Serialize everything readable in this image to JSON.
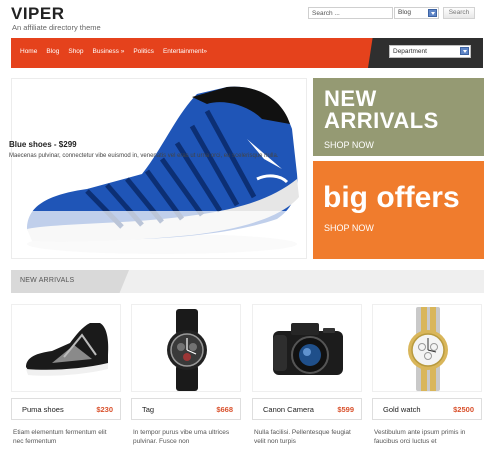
{
  "header": {
    "logo": "VIPER",
    "tagline": "An affiliate directory theme",
    "search_placeholder": "Search ...",
    "search_scope": "Blog",
    "search_button": "Search"
  },
  "nav": {
    "items": [
      "Home",
      "Blog",
      "Shop",
      "Business »",
      "Politics",
      "Entertainment»"
    ],
    "department_select": "Department"
  },
  "hero": {
    "title": "Blue shoes - $299",
    "description": "Maecenas pulvinar, connectetur vibe euismod in, venenatis vel eras ut urna orci, eu scelerisque nulla."
  },
  "promos": {
    "new_arrivals_line1": "NEW",
    "new_arrivals_line2": "ARRIVALS",
    "new_arrivals_cta": "SHOP NOW",
    "big_offers": "big offers",
    "big_offers_cta": "SHOP NOW"
  },
  "section": {
    "title": "NEW ARRIVALS"
  },
  "products": [
    {
      "name": "Puma shoes",
      "price": "$230",
      "description": "Etiam elementum fermentum elit nec fermentum"
    },
    {
      "name": "Tag",
      "price": "$668",
      "description": "In tempor purus vibe uma ultrices pulvinar. Fusce non"
    },
    {
      "name": "Canon Camera",
      "price": "$599",
      "description": "Nulla facilisi. Pellentesque feugiat velit non turpis"
    },
    {
      "name": "Gold watch",
      "price": "$2500",
      "description": "Vestibulum ante ipsum primis in faucibus orci luctus et"
    }
  ],
  "colors": {
    "nav_orange": "#e5421c",
    "olive": "#959a73",
    "offer_orange": "#f07c2d",
    "price_red": "#d9512c"
  }
}
